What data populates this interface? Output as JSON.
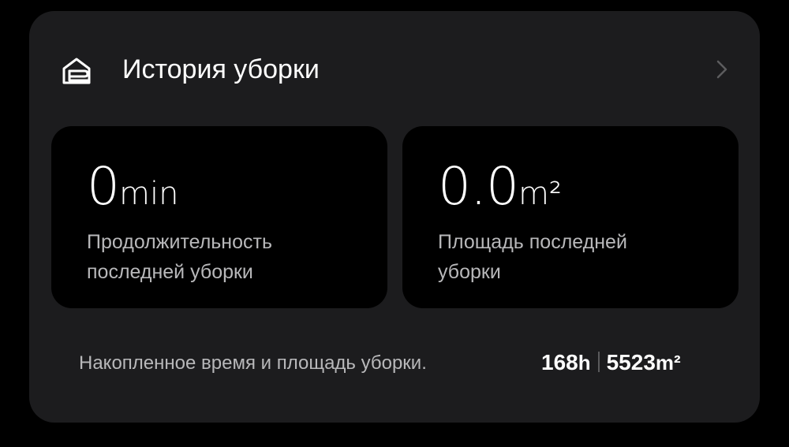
{
  "header": {
    "title": "История уборки",
    "icon": "cleaning-history-icon",
    "chevron_icon": "chevron-right-icon"
  },
  "last_cleaning": {
    "duration": {
      "value": "0",
      "unit": "min",
      "label_line1": "Продолжительность",
      "label_line2": "последней уборки"
    },
    "area": {
      "value": "0.0",
      "unit": "m²",
      "label_line1": "Площадь последней",
      "label_line2": "уборки"
    }
  },
  "totals": {
    "label": "Накопленное время и площадь уборки.",
    "time_value": "168",
    "time_unit": "h",
    "area_value": "5523",
    "area_unit": "m²"
  },
  "colors": {
    "background": "#000000",
    "card": "#1c1c1e",
    "tile": "#000000",
    "secondary_text": "#b8b8ba"
  }
}
